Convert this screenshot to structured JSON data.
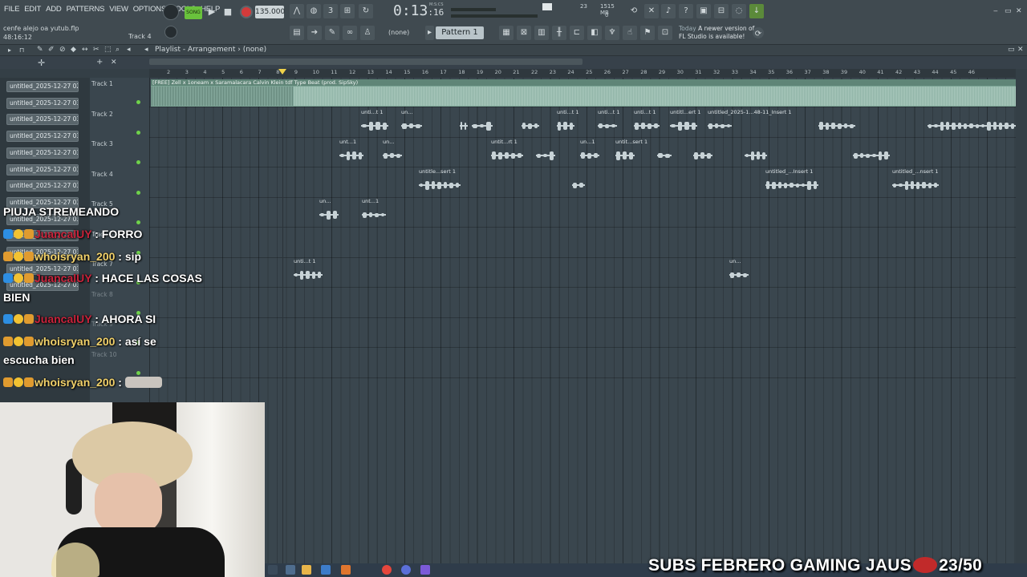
{
  "menu": [
    "FILE",
    "EDIT",
    "ADD",
    "PATTERNS",
    "VIEW",
    "OPTIONS",
    "TOOLS",
    "HELP"
  ],
  "hint_line1": "cenfe alejo oa yutub.flp",
  "hint_line2": "48:16:12",
  "hint_track": "Track 4",
  "song_mode": "SONG",
  "tempo": "135.000",
  "time_main": "0:13",
  "time_sub": ":16",
  "time_label": "M:S:CS",
  "cpu_count": "23",
  "memory": "1515 MB",
  "cpu_voices": "0",
  "pattern_none": "(none)",
  "pattern": "Pattern 1",
  "news_today": "Today",
  "news_text1": "A newer version of",
  "news_text2": "FL Studio is available!",
  "playlist_title": "Playlist - Arrangement",
  "playlist_sub": "(none)",
  "ruler": [
    "2",
    "3",
    "4",
    "5",
    "6",
    "7",
    "8",
    "9",
    "10",
    "11",
    "12",
    "13",
    "14",
    "15",
    "16",
    "17",
    "18",
    "19",
    "20",
    "21",
    "22",
    "23",
    "24",
    "25",
    "26",
    "27",
    "28",
    "29",
    "30",
    "31",
    "32",
    "33",
    "34",
    "35",
    "36",
    "37",
    "38",
    "39",
    "40",
    "41",
    "42",
    "43",
    "44",
    "45",
    "46"
  ],
  "channels": [
    "untitled_2025-12-27 02-...",
    "untitled_2025-12-27 03-...",
    "untitled_2025-12-27 03-...",
    "untitled_2025-12-27 03-...",
    "untitled_2025-12-27 03-...",
    "untitled_2025-12-27 03-...",
    "untitled_2025-12-27 03-...",
    "untitled_2025-12-27 03-...",
    "untitled_2025-12-27 03-...",
    "untitled_2025-12-27 03-...",
    "untitled_2025-12-27 03-...",
    "untitled_2025-12-27 03-...",
    "untitled_2025-12-27 03-..."
  ],
  "track_labels": [
    "Track 1",
    "Track 2",
    "Track 3",
    "Track 4",
    "Track 5",
    "Track 6",
    "Track 7",
    "Track 8",
    "Track 9",
    "Track 10"
  ],
  "main_clip_title": "[FREE] Zell x 1oneam x Saramalacara Calvin Klein  tdf Type Beat  (prod. SipSky)",
  "clips": {
    "track2": [
      "unti...t 1",
      "un...",
      "",
      "",
      "",
      "unti...t 1",
      "unti...t 1",
      "unti...t 1",
      "untitl...ert 1",
      "untitled_2025-1...48-11_Insert 1"
    ],
    "track3": [
      "unt...1",
      "un...",
      "untit...rt 1",
      "",
      "un...1",
      "untit...sert 1"
    ],
    "track4": [
      "untitle...sert 1",
      "",
      "untitled_...Insert 1",
      "untitled_...nsert 1"
    ],
    "track5": [
      "un...",
      "unt...1"
    ],
    "track7": [
      "unti...t 1",
      "un..."
    ]
  },
  "chat": {
    "title": "PIUJA STREMEANDO",
    "lines": [
      {
        "user": "JuancalUY",
        "text": ": FORRO"
      },
      {
        "user": "whoisryan_200",
        "text": ": sip"
      },
      {
        "user": "JuancalUY",
        "text": ": HACE LAS COSAS"
      },
      {
        "user": "",
        "text": "BIEN"
      },
      {
        "user": "JuancalUY",
        "text": ": AHORA SI"
      },
      {
        "user": "whoisryan_200",
        "text": ": así se"
      },
      {
        "user": "",
        "text": "escucha bien"
      },
      {
        "user": "whoisryan_200",
        "text": ":"
      }
    ]
  },
  "subs_text": "SUBS FEBRERO GAMING JAUS",
  "subs_count": "23/50",
  "colors": {
    "toolbar": "#404a50",
    "track_bg": "#3a464e",
    "audio_clip": "#7aa494",
    "accent_green": "#69c23c"
  }
}
